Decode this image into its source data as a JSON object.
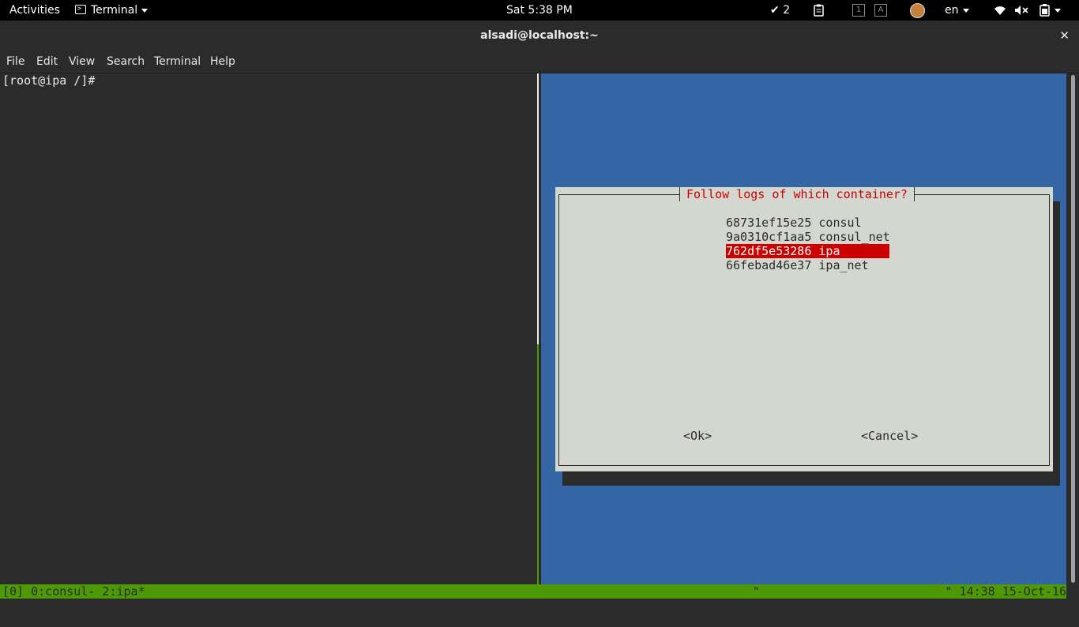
{
  "topbar": {
    "activities": "Activities",
    "app_name": "Terminal",
    "clock": "Sat  5:38 PM",
    "tasks_count": "2",
    "workspace_1": "1",
    "workspace_a": "A",
    "language": "en"
  },
  "window": {
    "title": "alsadi@localhost:~",
    "close": "✕"
  },
  "menu": {
    "items": [
      "File",
      "Edit",
      "View",
      "Search",
      "Terminal",
      "Help"
    ]
  },
  "terminal": {
    "prompt": "[root@ipa /]#"
  },
  "dialog": {
    "title": "Follow logs of which container?",
    "containers": [
      {
        "label": "68731ef15e25 consul"
      },
      {
        "label": "9a0310cf1aa5 consul_net"
      },
      {
        "label": "762df5e53286 ipa"
      },
      {
        "label": "66febad46e37 ipa_net"
      }
    ],
    "selected_index": 2,
    "ok_label": "<Ok>",
    "cancel_label": "<Cancel>"
  },
  "statusbar": {
    "left": "[0] 0:consul- 2:ipa*",
    "right": "\"                          \" 14:38 15-Oct-16"
  },
  "colors": {
    "desktop_blue": "#3465a4",
    "status_green": "#4e9a06",
    "selection_red": "#cc0000",
    "dialog_gray": "#d3d7cf"
  }
}
